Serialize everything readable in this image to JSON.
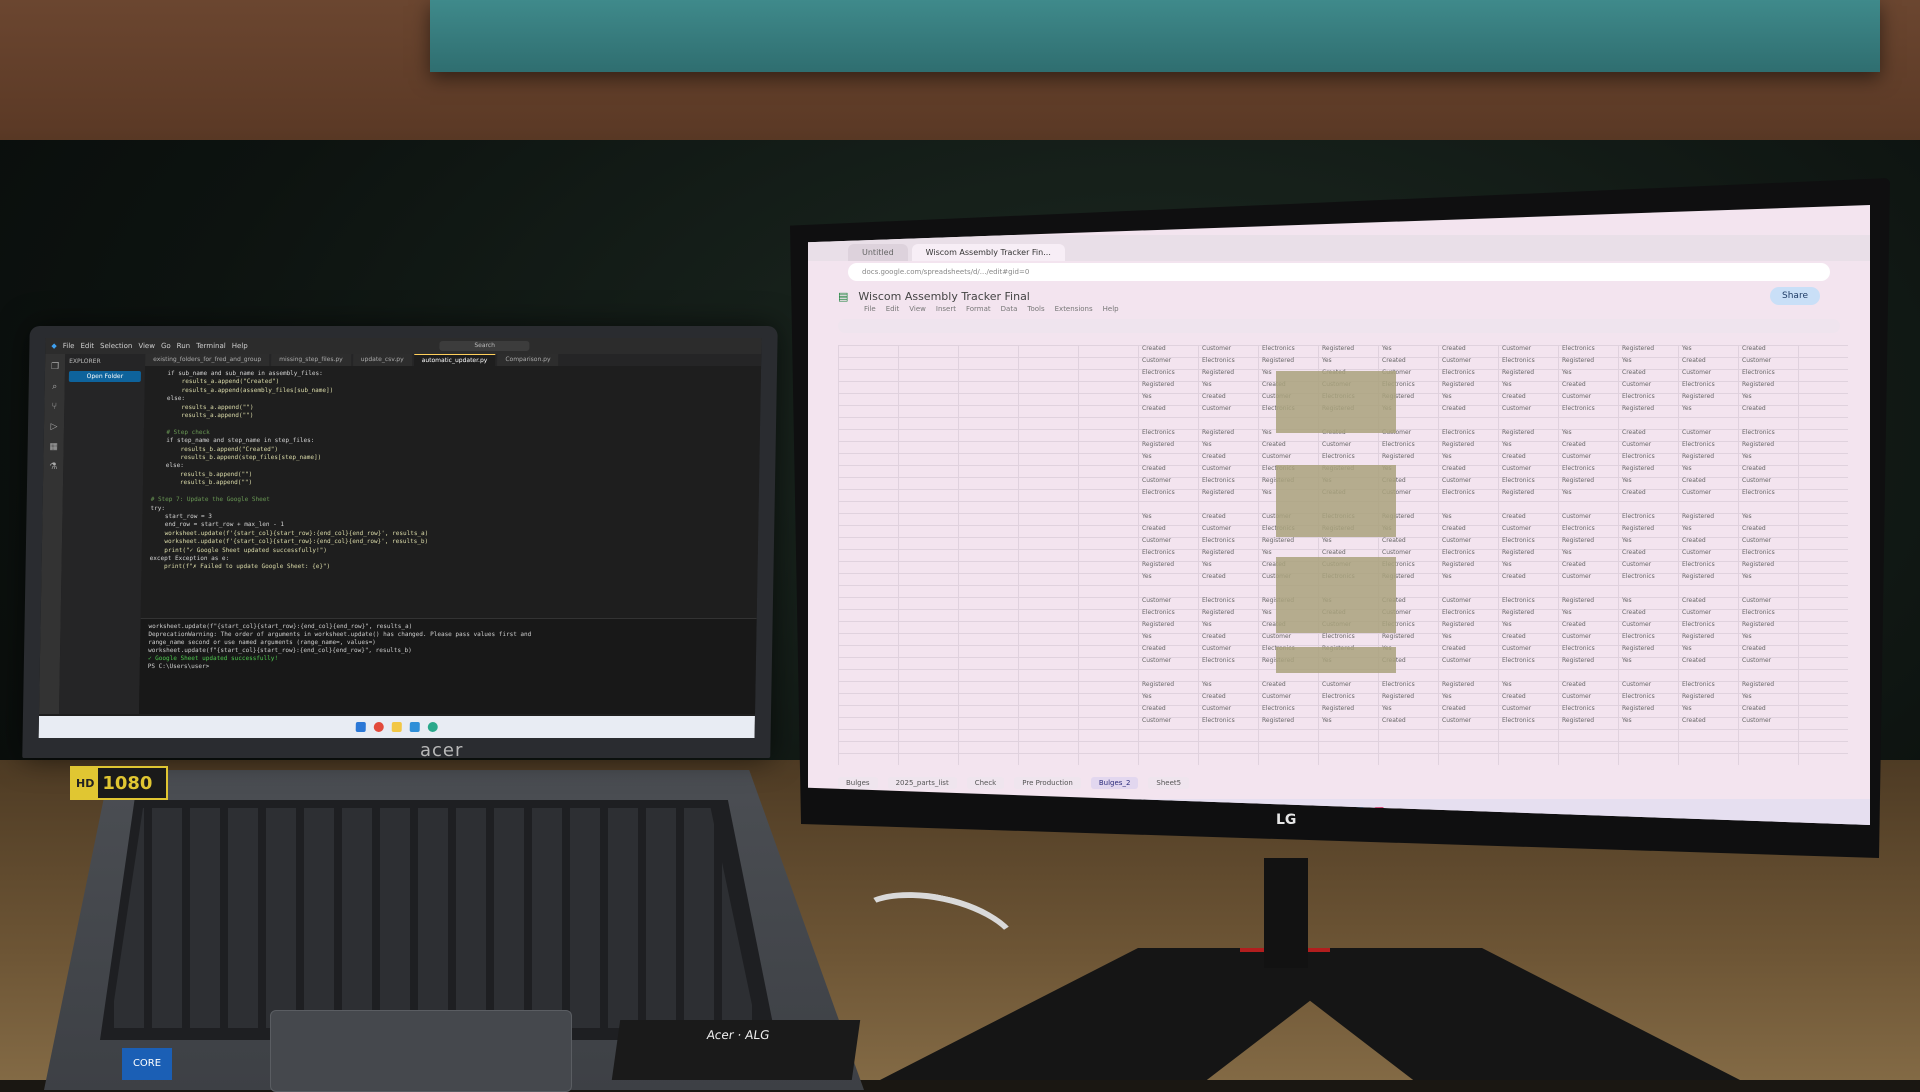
{
  "laptop": {
    "brand": "acer",
    "badge_hd": "HD",
    "badge_resolution": "1080",
    "intel_label": "CORE",
    "sticker_label": "Acer · ALG",
    "vscode": {
      "search_label": "Search",
      "menu": [
        "File",
        "Edit",
        "Selection",
        "View",
        "Go",
        "Run",
        "Terminal",
        "Help"
      ],
      "sidebar_title": "EXPLORER",
      "sidebar_button": "Open Folder",
      "tabs": [
        "existing_folders_for_fred_and_group",
        "missing_step_files.py",
        "update_csv.py",
        "automatic_updater.py",
        "Comparison.py"
      ],
      "active_tab_index": 3,
      "code_lines": [
        "    if sub_name and sub_name in assembly_files:",
        "        results_a.append(\"Created\")",
        "        results_a.append(assembly_files[sub_name])",
        "    else:",
        "        results_a.append(\"\")",
        "        results_a.append(\"\")",
        "",
        "    # Step check",
        "    if step_name and step_name in step_files:",
        "        results_b.append(\"Created\")",
        "        results_b.append(step_files[step_name])",
        "    else:",
        "        results_b.append(\"\")",
        "        results_b.append(\"\")",
        "",
        "# Step 7: Update the Google Sheet",
        "try:",
        "    start_row = 3",
        "    end_row = start_row + max_len - 1",
        "    worksheet.update(f'{start_col}{start_row}:{end_col}{end_row}', results_a)",
        "    worksheet.update(f'{start_col}{start_row}:{end_col}{end_row}', results_b)",
        "    print(\"✓ Google Sheet updated successfully!\")",
        "except Exception as e:",
        "    print(f\"✗ Failed to update Google Sheet: {e}\")"
      ],
      "terminal_lines": [
        "worksheet.update(f\"{start_col}{start_row}:{end_col}{end_row}\", results_a)",
        "DeprecationWarning: The order of arguments in worksheet.update() has changed. Please pass values first and",
        "range_name second or use named arguments (range_name=, values=)",
        "worksheet.update(f\"{start_col}{start_row}:{end_col}{end_row}\", results_b)",
        "✓ Google Sheet updated successfully!",
        "PS C:\\Users\\user>"
      ]
    }
  },
  "monitor": {
    "brand": "LG",
    "browser_tabs": [
      "Untitled",
      "Wiscom Assembly Tracker Fin..."
    ],
    "active_browser_tab": 1,
    "url": "docs.google.com/spreadsheets/d/.../edit#gid=0",
    "sheet_title": "Wiscom Assembly Tracker Final",
    "sheet_menu": [
      "File",
      "Edit",
      "View",
      "Insert",
      "Format",
      "Data",
      "Tools",
      "Extensions",
      "Help"
    ],
    "share_label": "Share",
    "sheet_tabs": [
      "Bulges",
      "2025_parts_list",
      "Check",
      "Pre Production",
      "Bulges_2",
      "Sheet5"
    ],
    "active_sheet_tab": 4,
    "visible_cell_words": [
      "Created",
      "Customer",
      "Electronics",
      "Registered",
      "Yes"
    ]
  }
}
